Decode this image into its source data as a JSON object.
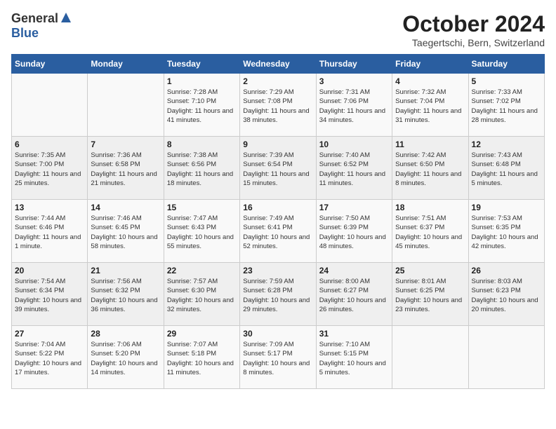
{
  "header": {
    "logo_general": "General",
    "logo_blue": "Blue",
    "month_title": "October 2024",
    "subtitle": "Taegertschi, Bern, Switzerland"
  },
  "days_of_week": [
    "Sunday",
    "Monday",
    "Tuesday",
    "Wednesday",
    "Thursday",
    "Friday",
    "Saturday"
  ],
  "weeks": [
    [
      {
        "day": "",
        "info": ""
      },
      {
        "day": "",
        "info": ""
      },
      {
        "day": "1",
        "info": "Sunrise: 7:28 AM\nSunset: 7:10 PM\nDaylight: 11 hours and 41 minutes."
      },
      {
        "day": "2",
        "info": "Sunrise: 7:29 AM\nSunset: 7:08 PM\nDaylight: 11 hours and 38 minutes."
      },
      {
        "day": "3",
        "info": "Sunrise: 7:31 AM\nSunset: 7:06 PM\nDaylight: 11 hours and 34 minutes."
      },
      {
        "day": "4",
        "info": "Sunrise: 7:32 AM\nSunset: 7:04 PM\nDaylight: 11 hours and 31 minutes."
      },
      {
        "day": "5",
        "info": "Sunrise: 7:33 AM\nSunset: 7:02 PM\nDaylight: 11 hours and 28 minutes."
      }
    ],
    [
      {
        "day": "6",
        "info": "Sunrise: 7:35 AM\nSunset: 7:00 PM\nDaylight: 11 hours and 25 minutes."
      },
      {
        "day": "7",
        "info": "Sunrise: 7:36 AM\nSunset: 6:58 PM\nDaylight: 11 hours and 21 minutes."
      },
      {
        "day": "8",
        "info": "Sunrise: 7:38 AM\nSunset: 6:56 PM\nDaylight: 11 hours and 18 minutes."
      },
      {
        "day": "9",
        "info": "Sunrise: 7:39 AM\nSunset: 6:54 PM\nDaylight: 11 hours and 15 minutes."
      },
      {
        "day": "10",
        "info": "Sunrise: 7:40 AM\nSunset: 6:52 PM\nDaylight: 11 hours and 11 minutes."
      },
      {
        "day": "11",
        "info": "Sunrise: 7:42 AM\nSunset: 6:50 PM\nDaylight: 11 hours and 8 minutes."
      },
      {
        "day": "12",
        "info": "Sunrise: 7:43 AM\nSunset: 6:48 PM\nDaylight: 11 hours and 5 minutes."
      }
    ],
    [
      {
        "day": "13",
        "info": "Sunrise: 7:44 AM\nSunset: 6:46 PM\nDaylight: 11 hours and 1 minute."
      },
      {
        "day": "14",
        "info": "Sunrise: 7:46 AM\nSunset: 6:45 PM\nDaylight: 10 hours and 58 minutes."
      },
      {
        "day": "15",
        "info": "Sunrise: 7:47 AM\nSunset: 6:43 PM\nDaylight: 10 hours and 55 minutes."
      },
      {
        "day": "16",
        "info": "Sunrise: 7:49 AM\nSunset: 6:41 PM\nDaylight: 10 hours and 52 minutes."
      },
      {
        "day": "17",
        "info": "Sunrise: 7:50 AM\nSunset: 6:39 PM\nDaylight: 10 hours and 48 minutes."
      },
      {
        "day": "18",
        "info": "Sunrise: 7:51 AM\nSunset: 6:37 PM\nDaylight: 10 hours and 45 minutes."
      },
      {
        "day": "19",
        "info": "Sunrise: 7:53 AM\nSunset: 6:35 PM\nDaylight: 10 hours and 42 minutes."
      }
    ],
    [
      {
        "day": "20",
        "info": "Sunrise: 7:54 AM\nSunset: 6:34 PM\nDaylight: 10 hours and 39 minutes."
      },
      {
        "day": "21",
        "info": "Sunrise: 7:56 AM\nSunset: 6:32 PM\nDaylight: 10 hours and 36 minutes."
      },
      {
        "day": "22",
        "info": "Sunrise: 7:57 AM\nSunset: 6:30 PM\nDaylight: 10 hours and 32 minutes."
      },
      {
        "day": "23",
        "info": "Sunrise: 7:59 AM\nSunset: 6:28 PM\nDaylight: 10 hours and 29 minutes."
      },
      {
        "day": "24",
        "info": "Sunrise: 8:00 AM\nSunset: 6:27 PM\nDaylight: 10 hours and 26 minutes."
      },
      {
        "day": "25",
        "info": "Sunrise: 8:01 AM\nSunset: 6:25 PM\nDaylight: 10 hours and 23 minutes."
      },
      {
        "day": "26",
        "info": "Sunrise: 8:03 AM\nSunset: 6:23 PM\nDaylight: 10 hours and 20 minutes."
      }
    ],
    [
      {
        "day": "27",
        "info": "Sunrise: 7:04 AM\nSunset: 5:22 PM\nDaylight: 10 hours and 17 minutes."
      },
      {
        "day": "28",
        "info": "Sunrise: 7:06 AM\nSunset: 5:20 PM\nDaylight: 10 hours and 14 minutes."
      },
      {
        "day": "29",
        "info": "Sunrise: 7:07 AM\nSunset: 5:18 PM\nDaylight: 10 hours and 11 minutes."
      },
      {
        "day": "30",
        "info": "Sunrise: 7:09 AM\nSunset: 5:17 PM\nDaylight: 10 hours and 8 minutes."
      },
      {
        "day": "31",
        "info": "Sunrise: 7:10 AM\nSunset: 5:15 PM\nDaylight: 10 hours and 5 minutes."
      },
      {
        "day": "",
        "info": ""
      },
      {
        "day": "",
        "info": ""
      }
    ]
  ]
}
